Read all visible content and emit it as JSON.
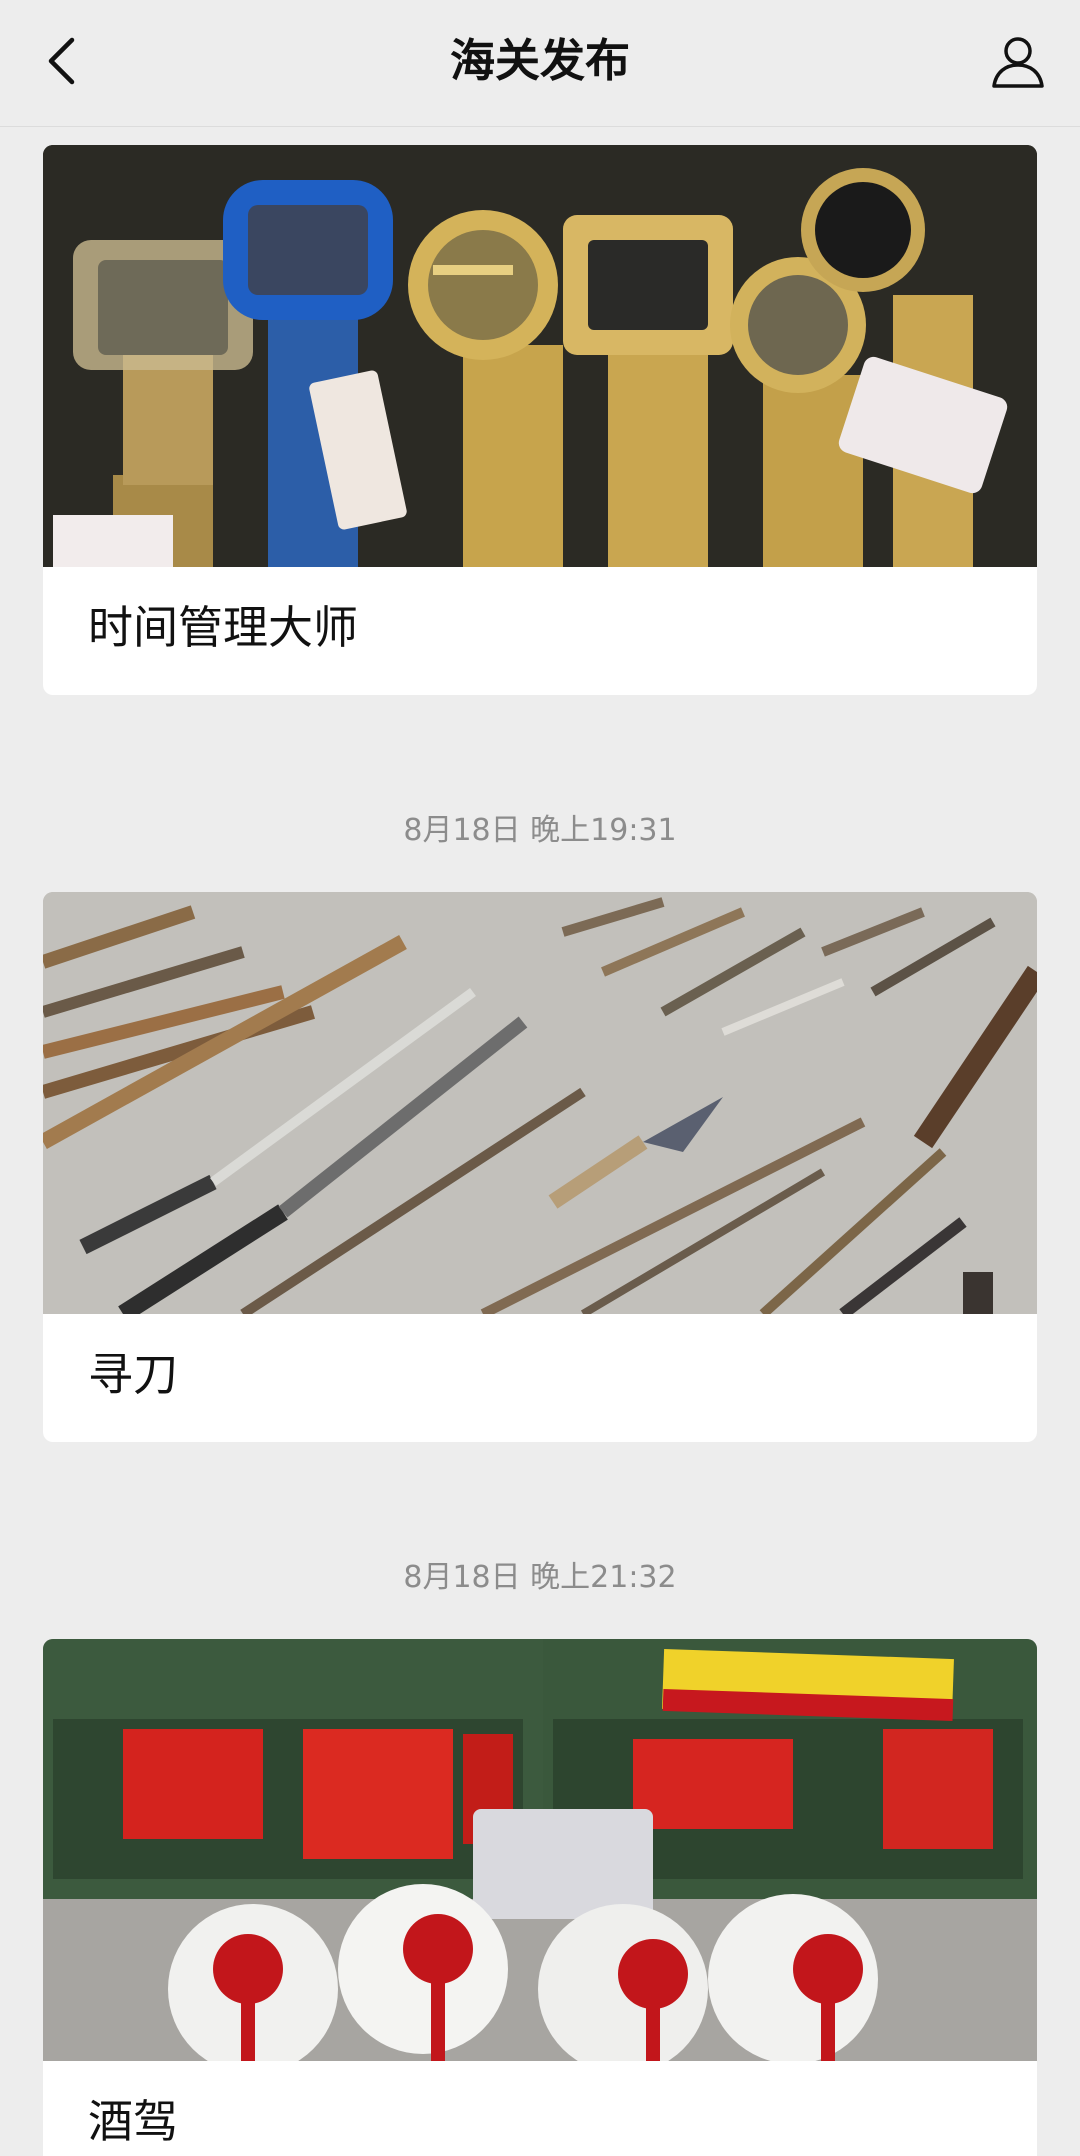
{
  "nav": {
    "title": "海关发布",
    "back_icon": "chevron-left-icon",
    "profile_icon": "person-icon"
  },
  "posts": [
    {
      "title": "时间管理大师",
      "image": "seized-wristwatches-photo"
    },
    {
      "timestamp": "8月18日 晚上19:31",
      "title": "寻刀",
      "image": "seized-knives-swords-photo"
    },
    {
      "timestamp": "8月18日 晚上21:32",
      "title": "酒驾",
      "image": "seized-liquor-boxes-photo"
    }
  ],
  "colors": {
    "background": "#ededed",
    "card": "#ffffff",
    "timestamp": "#8c8c8c",
    "title_text": "#111111"
  }
}
